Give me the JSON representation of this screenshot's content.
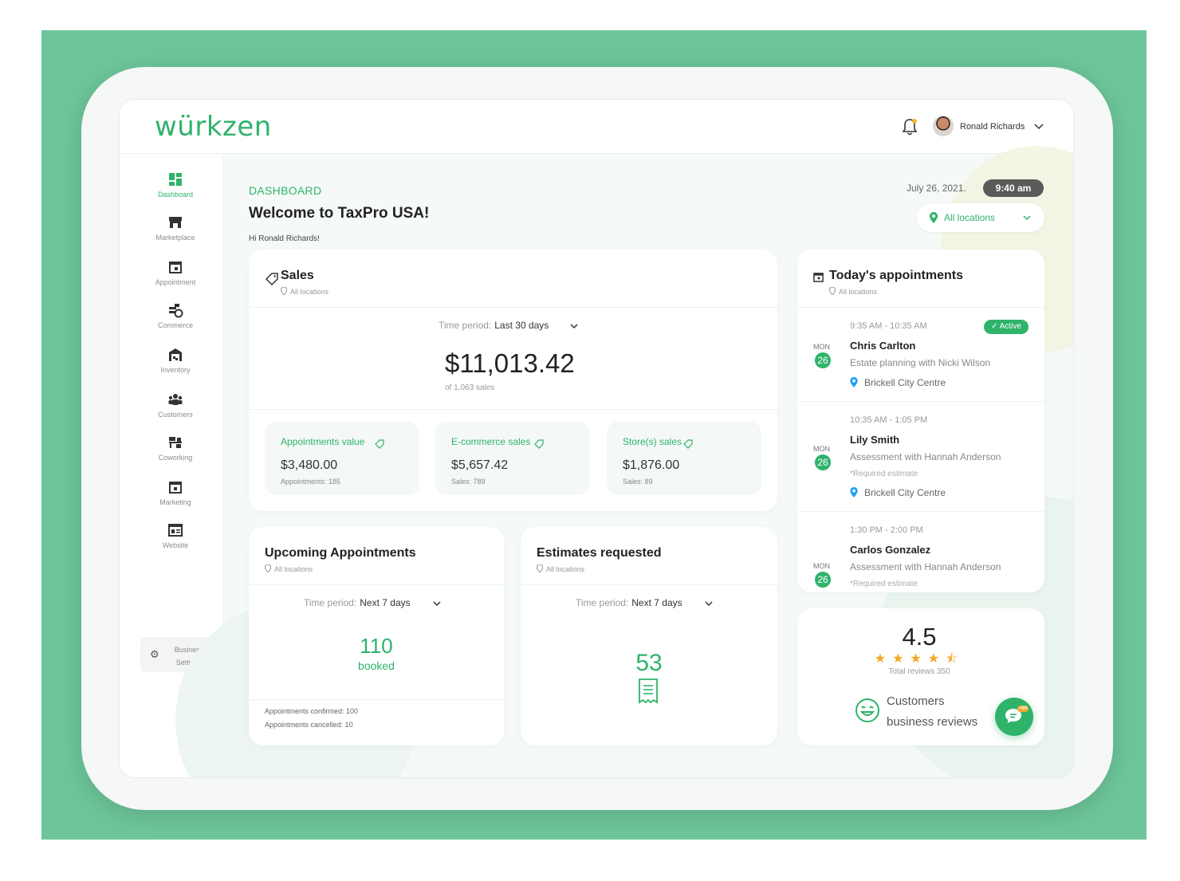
{
  "app": {
    "logo": "würkzen",
    "user_name": "Ronald Richards"
  },
  "colors": {
    "brand_green": "#2fb36b",
    "background_green": "#6dc69a",
    "star": "#f5a623",
    "pill_dark": "#5a5a5a"
  },
  "sidebar": {
    "items": [
      {
        "label": "Dashboard",
        "icon": "dashboard-icon",
        "active": true
      },
      {
        "label": "Marketplace",
        "icon": "store-icon"
      },
      {
        "label": "Appointment",
        "icon": "calendar-icon"
      },
      {
        "label": "Commerce",
        "icon": "commerce-icon"
      },
      {
        "label": "Inventory",
        "icon": "warehouse-icon"
      },
      {
        "label": "Customers",
        "icon": "people-icon"
      },
      {
        "label": "Coworking",
        "icon": "desk-icon"
      },
      {
        "label": "Marketing",
        "icon": "calendar-icon"
      },
      {
        "label": "Website",
        "icon": "website-icon"
      }
    ],
    "business_settings": "Business Settings"
  },
  "header": {
    "eyebrow": "DASHBOARD",
    "welcome": "Welcome to TaxPro USA!",
    "greeting": "Hi Ronald Richards!",
    "date": "July 26, 2021.",
    "time": "9:40 am",
    "location_filter": "All locations"
  },
  "sales": {
    "title": "Sales",
    "location": "All locations",
    "time_period_label": "Time period:",
    "time_period_value": "Last 30 days",
    "total": "$11,013.42",
    "total_sub": "of 1,063 sales",
    "breakdown": [
      {
        "title": "Appointments value",
        "value": "$3,480.00",
        "sub": "Appointments: 185"
      },
      {
        "title": "E-commerce sales",
        "value": "$5,657.42",
        "sub": "Sales: 789"
      },
      {
        "title": "Store(s) sales",
        "value": "$1,876.00",
        "sub": "Sales: 89"
      }
    ]
  },
  "upcoming": {
    "title": "Upcoming Appointments",
    "location": "All locations",
    "time_period_label": "Time period:",
    "time_period_value": "Next 7 days",
    "count": "110",
    "count_label": "booked",
    "confirmed": "Appointments confirmed: 100",
    "cancelled": "Appointments cancelled: 10"
  },
  "estimates": {
    "title": "Estimates requested",
    "location": "All locations",
    "time_period_label": "Time period:",
    "time_period_value": "Next 7 days",
    "count": "53"
  },
  "today": {
    "title": "Today's appointments",
    "location": "All locations",
    "appointments": [
      {
        "time": "9:35 AM - 10:35 AM",
        "name": "Chris Carlton",
        "desc": "Estate planning with Nicki Wilson",
        "note": "",
        "place": "Brickell City Centre",
        "dow": "MON",
        "day": "26",
        "badge": "✓ Active"
      },
      {
        "time": "10:35 AM - 1:05 PM",
        "name": "Lily Smith",
        "desc": "Assessment with Hannah Anderson",
        "note": "*Required estimate",
        "place": "Brickell City Centre",
        "dow": "MON",
        "day": "26"
      },
      {
        "time": "1:30 PM - 2:00 PM",
        "name": "Carlos Gonzalez",
        "desc": "Assessment with Hannah Anderson",
        "note": "*Required estimate",
        "place": "",
        "dow": "MON",
        "day": "26"
      }
    ]
  },
  "reviews": {
    "rating": "4.5",
    "rating_value": 4.5,
    "stars_text": "★★★★⯪",
    "total": "Total reviews 350",
    "label_line1": "Customers",
    "label_line2": "business reviews",
    "chat_badge": "+99"
  }
}
